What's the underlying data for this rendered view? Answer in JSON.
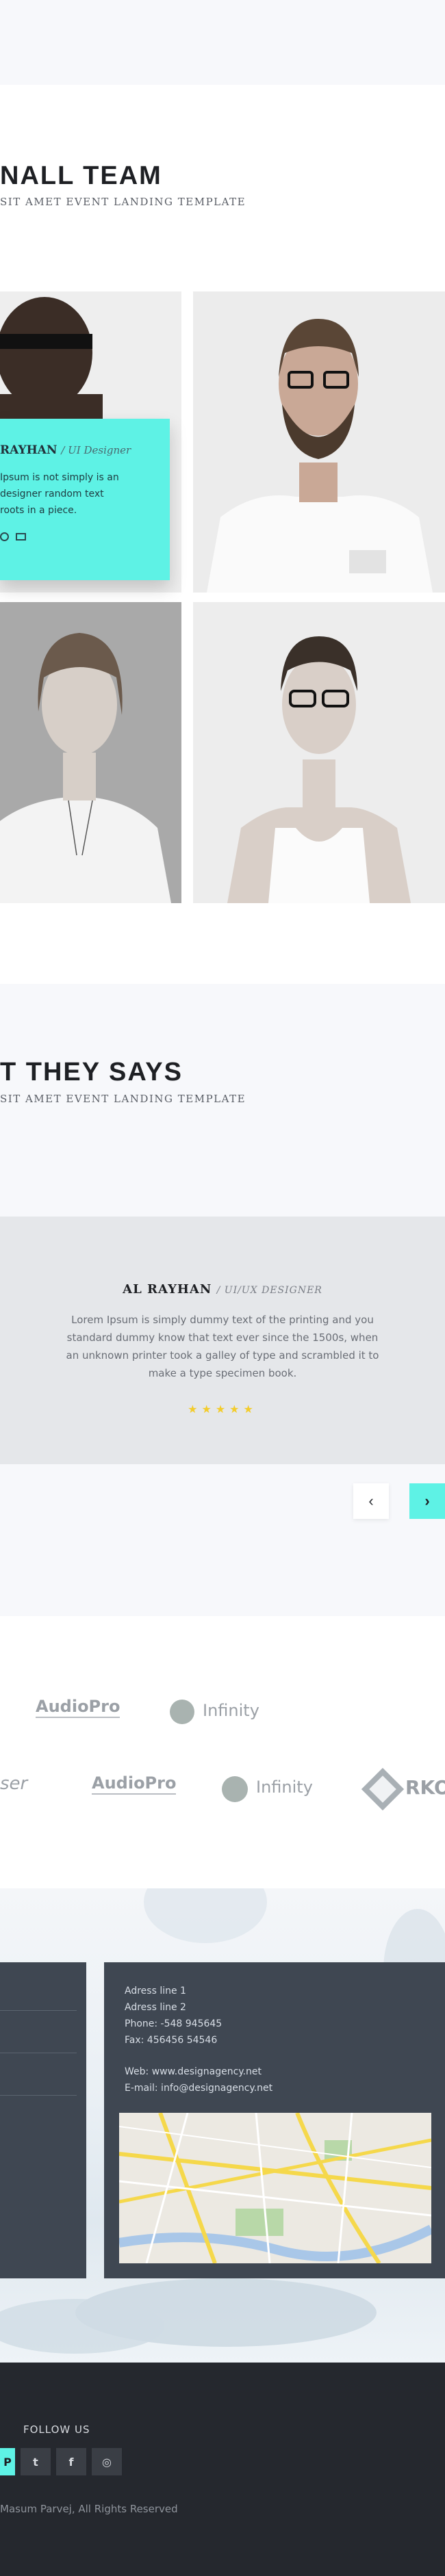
{
  "team_section": {
    "title": "NALL TEAM",
    "subtitle": "SIT AMET EVENT LANDING TEMPLATE",
    "card": {
      "name": "RAYHAN",
      "role": "/ UI Designer",
      "text_lines": [
        "Ipsum is not simply is  an",
        "designer random text",
        "roots in a piece."
      ]
    }
  },
  "testimonial_section": {
    "title": "T THEY SAYS",
    "subtitle": "SIT AMET EVENT LANDING TEMPLATE",
    "name": "AL RAYHAN",
    "role": "/ UI/UX DESIGNER",
    "text_lines": [
      "Lorem Ipsum is simply dummy text of the printing and you",
      "standard dummy know that text ever since the 1500s, when",
      "an unknown printer took a galley of type and scrambled it to",
      "make a type specimen book."
    ],
    "rating": 5,
    "stars": "★★★★★",
    "prev_symbol": "‹",
    "next_symbol": "›"
  },
  "logos": {
    "row1": [
      "AudioPro",
      "Infinity"
    ],
    "row2": [
      "ser",
      "AudioPro",
      "Infinity",
      "RKO"
    ]
  },
  "contact": {
    "address_line1": "Adress line 1",
    "address_line2": "Adress line 2",
    "phone": "Phone: -548 945645",
    "fax": "Fax: 456456 54546",
    "web": "Web: www.designagency.net",
    "email": "E-mail: info@designagency.net"
  },
  "footer": {
    "follow_label": "FOLLOW US",
    "social_icons": [
      "pinterest-icon",
      "twitter-icon",
      "facebook-icon",
      "dribbble-icon"
    ],
    "social_glyphs": [
      "P",
      "t",
      "f",
      "◎"
    ],
    "copyright": "Masum Parvej, All Rights Reserved"
  },
  "colors": {
    "accent": "#5ef2e5",
    "star": "#f3cc2b",
    "footer_bg": "#25282e",
    "panel_bg": "#3f4752",
    "section_bg": "#f7f8fb"
  }
}
